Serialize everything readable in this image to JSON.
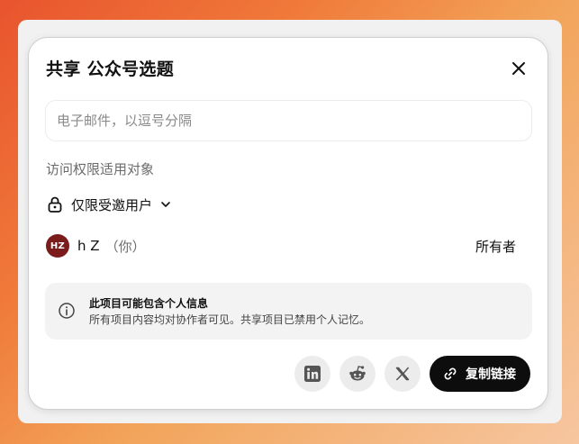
{
  "dialog": {
    "title": "共享 公众号选题",
    "email_placeholder": "电子邮件，以逗号分隔",
    "access_section_label": "访问权限适用对象",
    "access_level": "仅限受邀用户",
    "owner": {
      "initials": "HZ",
      "name": "h Z",
      "you_tag": "（你）",
      "role": "所有者",
      "avatar_color": "#7a1c1c"
    },
    "notice": {
      "title": "此项目可能包含个人信息",
      "body": "所有项目内容均对协作者可见。共享项目已禁用个人记忆。"
    },
    "share": {
      "buttons": [
        {
          "icon": "linkedin-icon"
        },
        {
          "icon": "reddit-icon"
        },
        {
          "icon": "x-icon"
        }
      ],
      "copy_label": "复制链接"
    }
  }
}
